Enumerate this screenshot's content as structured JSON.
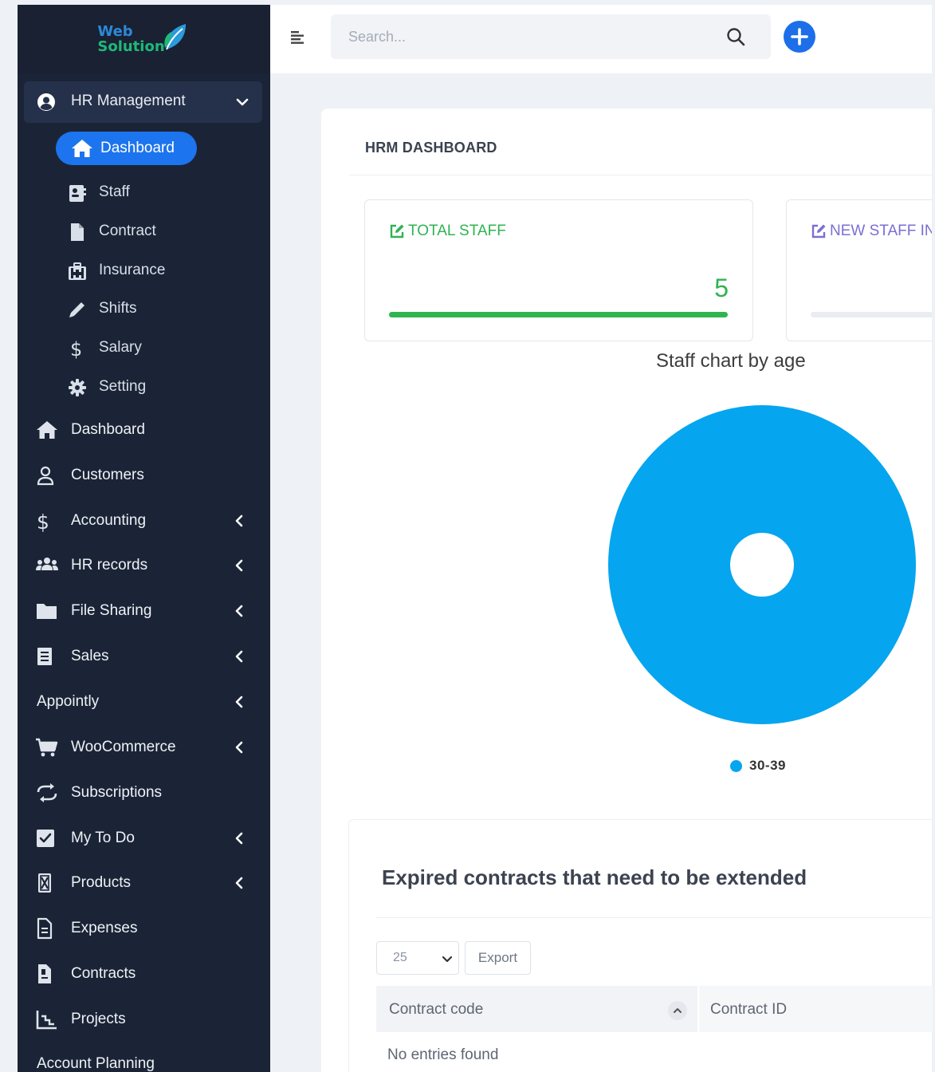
{
  "brand": {
    "line1": "Web",
    "line2": "Solution"
  },
  "sidebar": {
    "group": {
      "label": "HR Management",
      "icon": "user-circle-icon"
    },
    "subitems": [
      {
        "label": "Dashboard",
        "icon": "home-icon",
        "active": true
      },
      {
        "label": "Staff",
        "icon": "id-card-icon"
      },
      {
        "label": "Contract",
        "icon": "file-icon"
      },
      {
        "label": "Insurance",
        "icon": "briefcase-medical-icon"
      },
      {
        "label": "Shifts",
        "icon": "pencil-icon"
      },
      {
        "label": "Salary",
        "icon": "dollar-icon"
      },
      {
        "label": "Setting",
        "icon": "gear-icon"
      }
    ],
    "items": [
      {
        "label": "Dashboard",
        "icon": "home-icon"
      },
      {
        "label": "Customers",
        "icon": "user-icon"
      },
      {
        "label": "Accounting",
        "icon": "dollar-icon"
      },
      {
        "label": "HR records",
        "icon": "users-icon"
      },
      {
        "label": "File Sharing",
        "icon": "folder-icon"
      },
      {
        "label": "Sales",
        "icon": "receipt-icon"
      },
      {
        "label": "Appointly"
      },
      {
        "label": "WooCommerce",
        "icon": "cart-icon"
      },
      {
        "label": "Subscriptions",
        "icon": "repeat-icon"
      },
      {
        "label": "My To Do",
        "icon": "check-square-icon"
      },
      {
        "label": "Products",
        "icon": "box-icon"
      },
      {
        "label": "Expenses",
        "icon": "document-icon"
      },
      {
        "label": "Contracts",
        "icon": "contract-icon"
      },
      {
        "label": "Projects",
        "icon": "chart-icon"
      },
      {
        "label": "Account Planning"
      }
    ]
  },
  "topbar": {
    "search_placeholder": "Search..."
  },
  "page": {
    "title": "HRM DASHBOARD"
  },
  "stats": {
    "total_staff": {
      "title": "TOTAL STAFF",
      "value": "5",
      "progress": 1.0
    },
    "new_staff": {
      "title": "NEW STAFF IN",
      "progress": 0
    }
  },
  "colors": {
    "sidebar_bg": "#1b2436",
    "accent": "#1c74ee",
    "success": "#2fb352",
    "chart_blue": "#06a5ef"
  },
  "chart_data": {
    "type": "pie",
    "title": "Staff chart by age",
    "categories": [
      "30-39"
    ],
    "values": [
      5
    ],
    "legend": "bottom"
  },
  "contracts": {
    "title": "Expired contracts that need to be extended",
    "page_size": "25",
    "export_label": "Export",
    "columns": [
      "Contract code",
      "Contract ID"
    ],
    "empty_text": "No entries found"
  }
}
